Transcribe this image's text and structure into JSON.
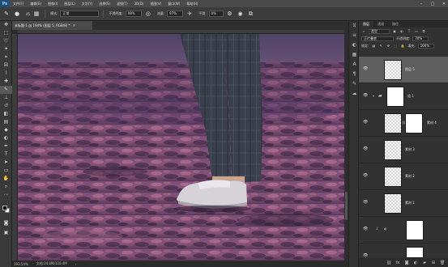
{
  "menubar": {
    "logo": "Ps",
    "items": [
      "文件(F)",
      "编辑(E)",
      "图像(I)",
      "图层(L)",
      "文字(Y)",
      "选择(S)",
      "滤镜(T)",
      "3D(D)",
      "视图(V)",
      "窗口(W)",
      "帮助(H)"
    ],
    "minimize": "–",
    "maximize": "□",
    "close": "✕"
  },
  "options": {
    "brush_size": "45",
    "mode_label": "模式:",
    "mode_value": "正常",
    "opacity_label": "不透明度:",
    "opacity_value": "98%",
    "flow_label": "流量:",
    "flow_value": "97%",
    "smooth_label": "平滑:",
    "smooth_value": "0%"
  },
  "document": {
    "tab_title": "未标题-1 @ 194% (图层 5, RGB/8) *",
    "close": "×"
  },
  "status": {
    "zoom": "193.54%",
    "doc_size": "文档:24.0M/120.4M"
  },
  "panel": {
    "tabs": [
      "图层",
      "通道",
      "路径"
    ],
    "kind_label": "类型",
    "blend_mode": "正片叠底",
    "opacity_label": "不透明度:",
    "opacity_value": "70%",
    "lock_label": "锁定:",
    "fill_label": "填充:",
    "fill_value": "100%"
  },
  "layers": [
    {
      "name": "图层 5"
    },
    {
      "name": "组 1"
    },
    {
      "name": "素材 4"
    },
    {
      "name": "素材 3"
    },
    {
      "name": "素材 2"
    },
    {
      "name": "素材 1"
    },
    {
      "name": ""
    },
    {
      "name": ""
    }
  ],
  "colors": {
    "canvas_sky": "#5a4a72",
    "sand_light": "#b06a8a",
    "sand_dark": "#3a2a48",
    "selected_layer": "#5f5f5f",
    "panel_bg": "#323232"
  }
}
